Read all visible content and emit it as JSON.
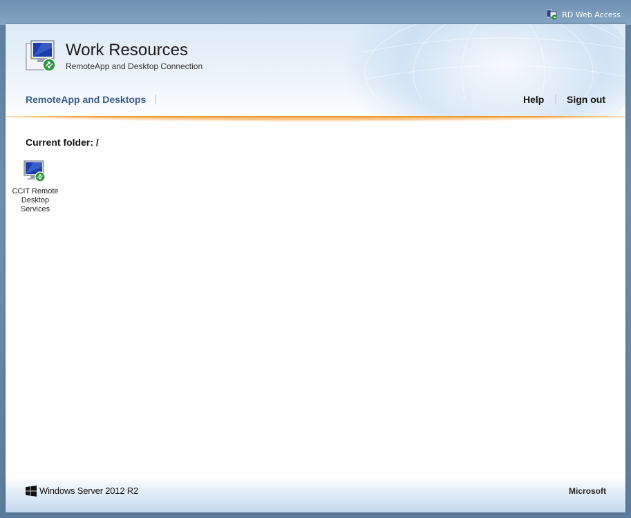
{
  "top": {
    "rd_web_access": "RD Web Access"
  },
  "header": {
    "title": "Work Resources",
    "subtitle": "RemoteApp and Desktop Connection"
  },
  "nav": {
    "remoteapp": "RemoteApp and Desktops",
    "help": "Help",
    "signout": "Sign out",
    "separator": "|"
  },
  "content": {
    "current_folder": "Current folder: /",
    "resources": [
      {
        "label_lines": [
          "CCIT Remote",
          "Desktop",
          "Services"
        ],
        "icon": "remote-desktop-icon"
      }
    ]
  },
  "footer": {
    "windows": "Windows Server 2012 R2",
    "microsoft": "Microsoft"
  },
  "colors": {
    "accent_orange": "#f39a2f",
    "nav_blue": "#3a5d8a"
  }
}
